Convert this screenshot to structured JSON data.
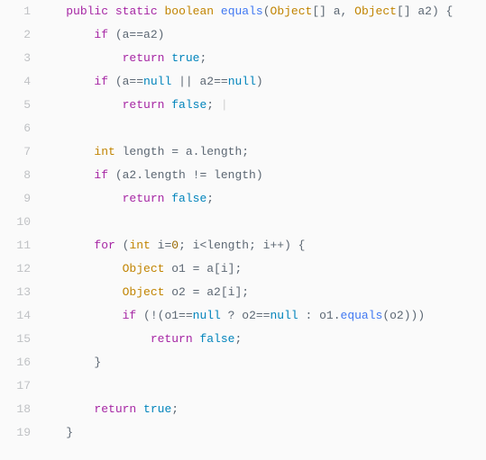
{
  "gutter": {
    "start": 1,
    "end": 19
  },
  "code": {
    "tokens": [
      [
        [
          "sp",
          "    "
        ],
        [
          "kw",
          "public"
        ],
        [
          "sp",
          " "
        ],
        [
          "kw",
          "static"
        ],
        [
          "sp",
          " "
        ],
        [
          "type",
          "boolean"
        ],
        [
          "sp",
          " "
        ],
        [
          "fn",
          "equals"
        ],
        [
          "op",
          "("
        ],
        [
          "type",
          "Object"
        ],
        [
          "op",
          "[] a, "
        ],
        [
          "type",
          "Object"
        ],
        [
          "op",
          "[] a2) {"
        ]
      ],
      [
        [
          "sp",
          "        "
        ],
        [
          "kw",
          "if"
        ],
        [
          "op",
          " (a==a2)"
        ]
      ],
      [
        [
          "sp",
          "            "
        ],
        [
          "kw",
          "return"
        ],
        [
          "sp",
          " "
        ],
        [
          "lit",
          "true"
        ],
        [
          "op",
          ";"
        ]
      ],
      [
        [
          "sp",
          "        "
        ],
        [
          "kw",
          "if"
        ],
        [
          "op",
          " (a=="
        ],
        [
          "lit",
          "null"
        ],
        [
          "op",
          " || a2=="
        ],
        [
          "lit",
          "null"
        ],
        [
          "op",
          ")"
        ]
      ],
      [
        [
          "sp",
          "            "
        ],
        [
          "kw",
          "return"
        ],
        [
          "sp",
          " "
        ],
        [
          "lit",
          "false"
        ],
        [
          "op",
          "; "
        ],
        [
          "cursor",
          "|"
        ]
      ],
      [
        [
          "sp",
          ""
        ]
      ],
      [
        [
          "sp",
          "        "
        ],
        [
          "type",
          "int"
        ],
        [
          "op",
          " length = a.length;"
        ]
      ],
      [
        [
          "sp",
          "        "
        ],
        [
          "kw",
          "if"
        ],
        [
          "op",
          " (a2.length != length)"
        ]
      ],
      [
        [
          "sp",
          "            "
        ],
        [
          "kw",
          "return"
        ],
        [
          "sp",
          " "
        ],
        [
          "lit",
          "false"
        ],
        [
          "op",
          ";"
        ]
      ],
      [
        [
          "sp",
          ""
        ]
      ],
      [
        [
          "sp",
          "        "
        ],
        [
          "kw",
          "for"
        ],
        [
          "op",
          " ("
        ],
        [
          "type",
          "int"
        ],
        [
          "op",
          " i="
        ],
        [
          "num",
          "0"
        ],
        [
          "op",
          "; i<length; i++) {"
        ]
      ],
      [
        [
          "sp",
          "            "
        ],
        [
          "type",
          "Object"
        ],
        [
          "op",
          " o1 = a[i];"
        ]
      ],
      [
        [
          "sp",
          "            "
        ],
        [
          "type",
          "Object"
        ],
        [
          "op",
          " o2 = a2[i];"
        ]
      ],
      [
        [
          "sp",
          "            "
        ],
        [
          "kw",
          "if"
        ],
        [
          "op",
          " (!(o1=="
        ],
        [
          "lit",
          "null"
        ],
        [
          "op",
          " ? o2=="
        ],
        [
          "lit",
          "null"
        ],
        [
          "op",
          " : o1."
        ],
        [
          "fn",
          "equals"
        ],
        [
          "op",
          "(o2)))"
        ]
      ],
      [
        [
          "sp",
          "                "
        ],
        [
          "kw",
          "return"
        ],
        [
          "sp",
          " "
        ],
        [
          "lit",
          "false"
        ],
        [
          "op",
          ";"
        ]
      ],
      [
        [
          "sp",
          "        "
        ],
        [
          "op",
          "}"
        ]
      ],
      [
        [
          "sp",
          ""
        ]
      ],
      [
        [
          "sp",
          "        "
        ],
        [
          "kw",
          "return"
        ],
        [
          "sp",
          " "
        ],
        [
          "lit",
          "true"
        ],
        [
          "op",
          ";"
        ]
      ],
      [
        [
          "sp",
          "    "
        ],
        [
          "op",
          "}"
        ]
      ]
    ]
  }
}
